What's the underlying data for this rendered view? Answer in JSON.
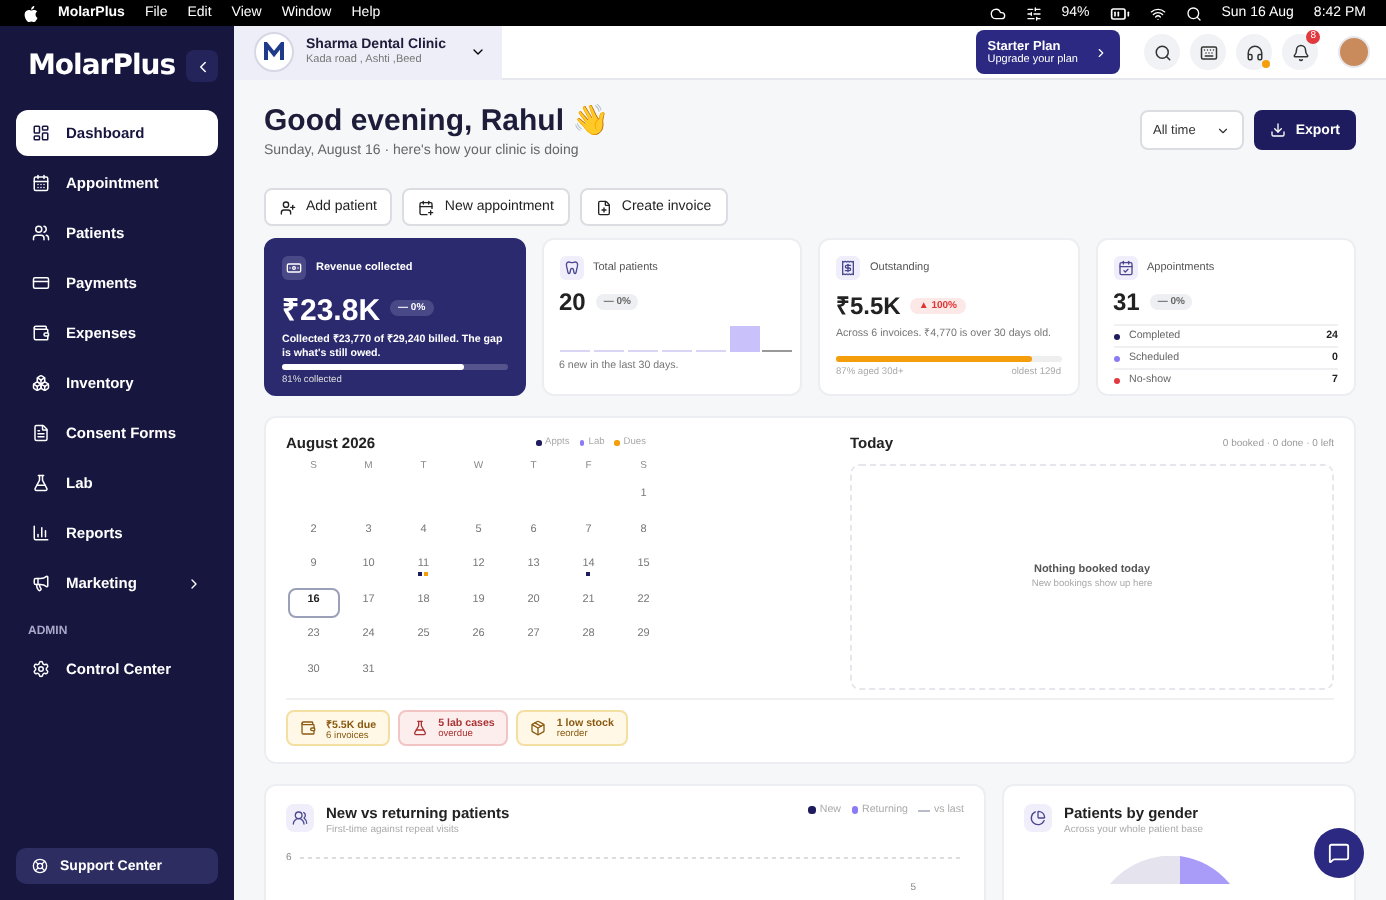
{
  "menubar": {
    "app": "MolarPlus",
    "menus": [
      "File",
      "Edit",
      "View",
      "Window",
      "Help"
    ],
    "battery": "94%",
    "date": "Sun 16 Aug",
    "time": "8:42 PM"
  },
  "sidebar": {
    "brand": "MolarPlus",
    "items": [
      {
        "label": "Dashboard",
        "selected": true,
        "expandable": false
      },
      {
        "label": "Appointment",
        "selected": false,
        "expandable": false
      },
      {
        "label": "Patients",
        "selected": false,
        "expandable": false
      },
      {
        "label": "Payments",
        "selected": false,
        "expandable": false
      },
      {
        "label": "Expenses",
        "selected": false,
        "expandable": false
      },
      {
        "label": "Inventory",
        "selected": false,
        "expandable": false
      },
      {
        "label": "Consent Forms",
        "selected": false,
        "expandable": false
      },
      {
        "label": "Lab",
        "selected": false,
        "expandable": false
      },
      {
        "label": "Reports",
        "selected": false,
        "expandable": false
      },
      {
        "label": "Marketing",
        "selected": false,
        "expandable": true
      }
    ],
    "section": "ADMIN",
    "admin_items": [
      {
        "label": "Control Center",
        "selected": false,
        "expandable": false
      }
    ],
    "support": "Support Center"
  },
  "header": {
    "clinic_name": "Sharma Dental Clinic",
    "clinic_address": "Kada road , Ashti ,Beed",
    "plan_title": "Starter Plan",
    "plan_subtitle": "Upgrade your plan",
    "notification_count": "8"
  },
  "greeting": {
    "title": "Good evening, Rahul 👋",
    "subtitle": "Sunday, August 16 · here's how your clinic is doing",
    "period": "All time",
    "export": "Export"
  },
  "actions": [
    {
      "label": "Add patient"
    },
    {
      "label": "New appointment"
    },
    {
      "label": "Create invoice"
    }
  ],
  "stats": [
    {
      "kind": "revenue",
      "title": "Revenue collected",
      "value": "₹23.8K",
      "change": "— 0%",
      "rising": false,
      "note": "Collected ₹23,770 of ₹29,240 billed. The gap is what's still owed.",
      "level": 0.81,
      "footer": "81% collected"
    },
    {
      "kind": "patients",
      "title": "Total patients",
      "value": "20",
      "change": "— 0%",
      "rising": false,
      "note": "6 new in the last 30 days."
    },
    {
      "kind": "outstanding",
      "title": "Outstanding",
      "value": "₹5.5K",
      "change": "▲ 100%",
      "rising": true,
      "note": "Across 6 invoices. ₹4,770 is over 30 days old.",
      "level": 0.87,
      "footer": "87% aged 30d+",
      "footer_right": "oldest 129d"
    },
    {
      "kind": "appointments",
      "title": "Appointments",
      "value": "31",
      "change": "— 0%",
      "rising": false,
      "breakdown": [
        {
          "label": "Completed",
          "count": "24",
          "color": "#1e1b5e"
        },
        {
          "label": "Scheduled",
          "count": "0",
          "color": "#8b7cf6"
        },
        {
          "label": "No-show",
          "count": "7",
          "color": "#e0393e"
        }
      ]
    }
  ],
  "calendar": {
    "title": "August 2026",
    "legend": [
      {
        "label": "Appts",
        "color": "#1e1b5e"
      },
      {
        "label": "Lab",
        "color": "#8b7cf6"
      },
      {
        "label": "Dues",
        "color": "#f59e0b"
      }
    ],
    "weekdays": [
      "S",
      "M",
      "T",
      "W",
      "T",
      "F",
      "S"
    ],
    "weeks": [
      {
        "kind": "end",
        "days": [
          {
            "day": "1",
            "selected": false
          }
        ]
      },
      {
        "kind": "full",
        "days": [
          {
            "day": "2",
            "selected": false
          },
          {
            "day": "3",
            "selected": false
          },
          {
            "day": "4",
            "selected": false
          },
          {
            "day": "5",
            "selected": false
          },
          {
            "day": "6",
            "selected": false
          },
          {
            "day": "7",
            "selected": false
          },
          {
            "day": "8",
            "selected": false
          }
        ]
      },
      {
        "kind": "full",
        "days": [
          {
            "day": "9",
            "selected": false
          },
          {
            "day": "10",
            "selected": false
          },
          {
            "day": "11",
            "selected": false,
            "dots": [
              {
                "color": "#1e1b5e"
              },
              {
                "color": "#f59e0b"
              }
            ]
          },
          {
            "day": "12",
            "selected": false
          },
          {
            "day": "13",
            "selected": false
          },
          {
            "day": "14",
            "selected": false,
            "dots": [
              {
                "color": "#1e1b5e"
              }
            ]
          },
          {
            "day": "15",
            "selected": false
          }
        ]
      },
      {
        "kind": "full",
        "days": [
          {
            "day": "16",
            "selected": true
          },
          {
            "day": "17",
            "selected": false
          },
          {
            "day": "18",
            "selected": false
          },
          {
            "day": "19",
            "selected": false
          },
          {
            "day": "20",
            "selected": false
          },
          {
            "day": "21",
            "selected": false
          },
          {
            "day": "22",
            "selected": false
          }
        ]
      },
      {
        "kind": "full",
        "days": [
          {
            "day": "23",
            "selected": false
          },
          {
            "day": "24",
            "selected": false
          },
          {
            "day": "25",
            "selected": false
          },
          {
            "day": "26",
            "selected": false
          },
          {
            "day": "27",
            "selected": false
          },
          {
            "day": "28",
            "selected": false
          },
          {
            "day": "29",
            "selected": false
          }
        ]
      },
      {
        "kind": "start",
        "days": [
          {
            "day": "30",
            "selected": false
          },
          {
            "day": "31",
            "selected": false
          }
        ]
      }
    ],
    "alerts": [
      {
        "kind": "due",
        "title": "₹5.5K due",
        "subtitle": "6 invoices"
      },
      {
        "kind": "lab",
        "title": "5 lab cases",
        "subtitle": "overdue"
      },
      {
        "kind": "stock",
        "title": "1 low stock",
        "subtitle": "reorder"
      }
    ]
  },
  "today": {
    "title": "Today",
    "summary": "0 booked · 0 done · 0 left",
    "empty_title": "Nothing booked today",
    "empty_subtitle": "New bookings show up here"
  },
  "trend_panel": {
    "title": "New vs returning patients",
    "subtitle": "First-time against repeat visits",
    "legend": [
      {
        "label": "New",
        "kind": "dot",
        "color": "#1e1b5e"
      },
      {
        "label": "Returning",
        "kind": "dot",
        "color": "#8b7cf6"
      },
      {
        "label": "vs last",
        "kind": "line",
        "color": "#b9bcc8"
      }
    ],
    "y_tick": "6",
    "point_label": "5"
  },
  "gender_panel": {
    "title": "Patients by gender",
    "subtitle": "Across your whole patient base"
  }
}
